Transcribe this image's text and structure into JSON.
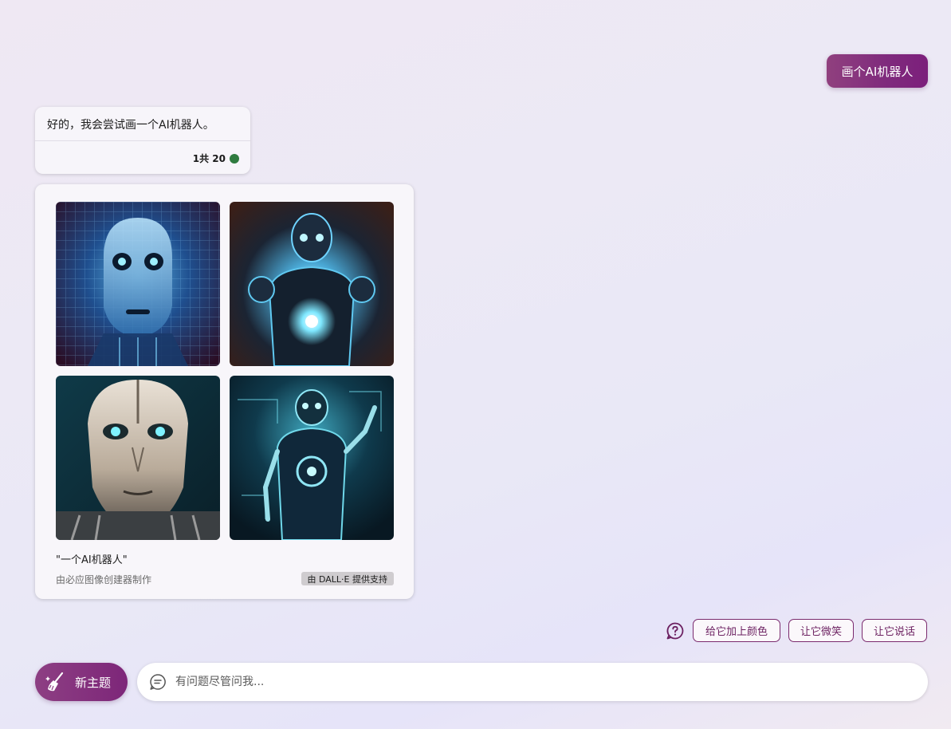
{
  "user_message": {
    "text": "画个AI机器人"
  },
  "bot_reply": {
    "text": "好的，我会尝试画一个AI机器人。",
    "counter": "1共 20",
    "status_color": "#2f7b3f"
  },
  "image_card": {
    "images": [
      {
        "alt": "AI robot head with grid pattern"
      },
      {
        "alt": "AI robot with glowing chest light"
      },
      {
        "alt": "AI robot chrome face close-up"
      },
      {
        "alt": "AI robot full body circuitry"
      }
    ],
    "caption": "\"一个AI机器人\"",
    "creator": "由必应图像创建器制作",
    "badge": "由 DALL·E 提供支持"
  },
  "suggestions": {
    "help_icon": "question-circle-icon",
    "chips": [
      "给它加上颜色",
      "让它微笑",
      "让它说话"
    ]
  },
  "composer": {
    "new_topic_label": "新主题",
    "new_topic_icon": "broom-icon",
    "chat_icon": "chat-bubble-icon",
    "placeholder": "有问题尽管问我..."
  },
  "colors": {
    "accent": "#7d2679",
    "accent_light": "#90407e"
  }
}
